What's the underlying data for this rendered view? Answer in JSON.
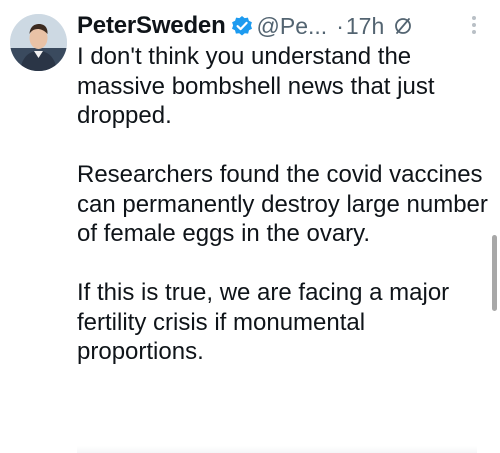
{
  "author": {
    "display_name": "PeterSweden",
    "handle": "@Pe...",
    "time": "17h",
    "separator": "·",
    "verified": true,
    "verified_color": "#1d9bf0"
  },
  "tweet": {
    "paragraphs": [
      "I don't think you understand the massive bombshell news that just dropped.",
      "Researchers found the covid vaccines can permanently destroy large number of female eggs in the ovary.",
      "If this is true, we are facing a major fertility crisis if monumental proportions."
    ]
  },
  "icons": {
    "avatar": "avatar",
    "verified": "verified-badge-icon",
    "grok": "grok-icon",
    "more": "more-options-icon"
  },
  "colors": {
    "text": "#0f1419",
    "secondary": "#536471",
    "background": "#ffffff"
  }
}
